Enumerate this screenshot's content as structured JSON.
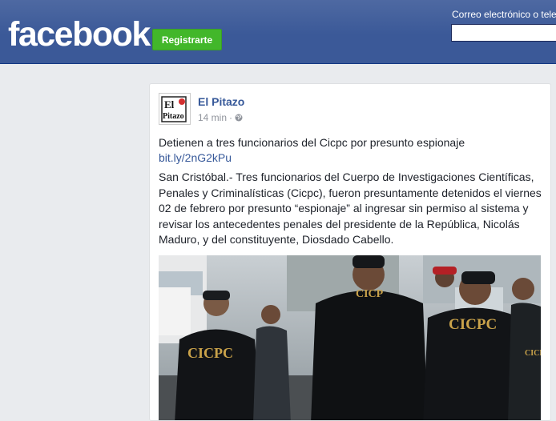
{
  "header": {
    "logo_text": "facebook",
    "signup_label": "Registrarte",
    "email_label": "Correo electrónico o tele",
    "email_value": ""
  },
  "post": {
    "page_name": "El Pitazo",
    "timestamp": "14 min",
    "separator": "·",
    "privacy_icon": "globe-icon",
    "avatar_text_1": "El",
    "avatar_text_2": "Pitazo",
    "headline": "Detienen a tres funcionarios del Cicpc por presunto espionaje",
    "link": "bit.ly/2nG2kPu",
    "body": "San Cristóbal.- Tres funcionarios del Cuerpo de Investigaciones Científicas, Penales y Criminalísticas (Cicpc), fueron presuntamente detenidos el viernes 02 de febrero por presunto “espionaje” al ingresar sin permiso al sistema y revisar los antecedentes penales del presidente de la República, Nicolás Maduro, y del constituyente, Diosdado Cabello.",
    "photo": {
      "vest_labels": [
        "CICPC",
        "CICP",
        "CICPC",
        "CICPC"
      ]
    }
  },
  "colors": {
    "brand_blue": "#3b5998",
    "signup_green": "#42b72a",
    "link_blue": "#365899"
  }
}
